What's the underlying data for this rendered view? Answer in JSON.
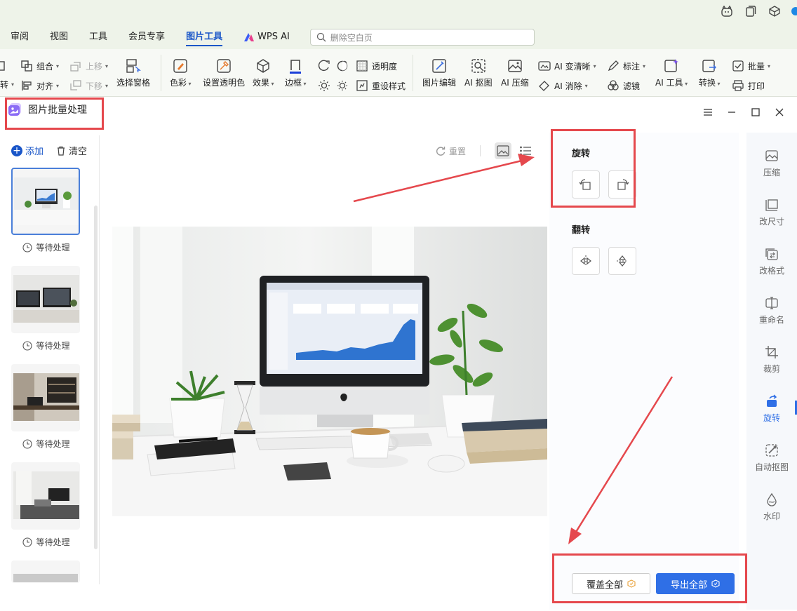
{
  "ribbon": {
    "tabs": [
      "审阅",
      "视图",
      "工具",
      "会员专享",
      "图片工具"
    ],
    "active_tab": "图片工具",
    "wps_ai": "WPS AI",
    "search_placeholder": "删除空白页"
  },
  "toolbar": {
    "group": "组合",
    "align": "对齐",
    "move_up": "上移",
    "move_down": "下移",
    "select_pane": "选择窗格",
    "color": "色彩",
    "set_transparent": "设置透明色",
    "effects": "效果",
    "border": "边框",
    "transparency": "透明度",
    "reset_style": "重设样式",
    "image_edit": "图片编辑",
    "ai_cutout": "AI 抠图",
    "ai_compress": "AI 压缩",
    "ai_sharpen": "AI 变清晰",
    "ai_erase": "AI 消除",
    "annotate": "标注",
    "filter": "滤镜",
    "ai_tools": "AI 工具",
    "convert": "转换",
    "batch": "批量",
    "print": "打印",
    "left_cut": "转"
  },
  "dialog": {
    "title": "图片批量处理",
    "add": "添加",
    "clear": "清空",
    "reset": "重置",
    "thumb_status": [
      "等待处理",
      "等待处理",
      "等待处理",
      "等待处理"
    ],
    "rotate_title": "旋转",
    "flip_title": "翻转",
    "overwrite_all": "覆盖全部",
    "export_all": "导出全部"
  },
  "sidenav": [
    "压缩",
    "改尺寸",
    "改格式",
    "重命名",
    "裁剪",
    "旋转",
    "自动抠图",
    "水印"
  ],
  "sidenav_active": "旋转",
  "colors": {
    "accent": "#2f6fe6",
    "annotation": "#e5484d",
    "ribbon_bg": "#eef3e9"
  }
}
